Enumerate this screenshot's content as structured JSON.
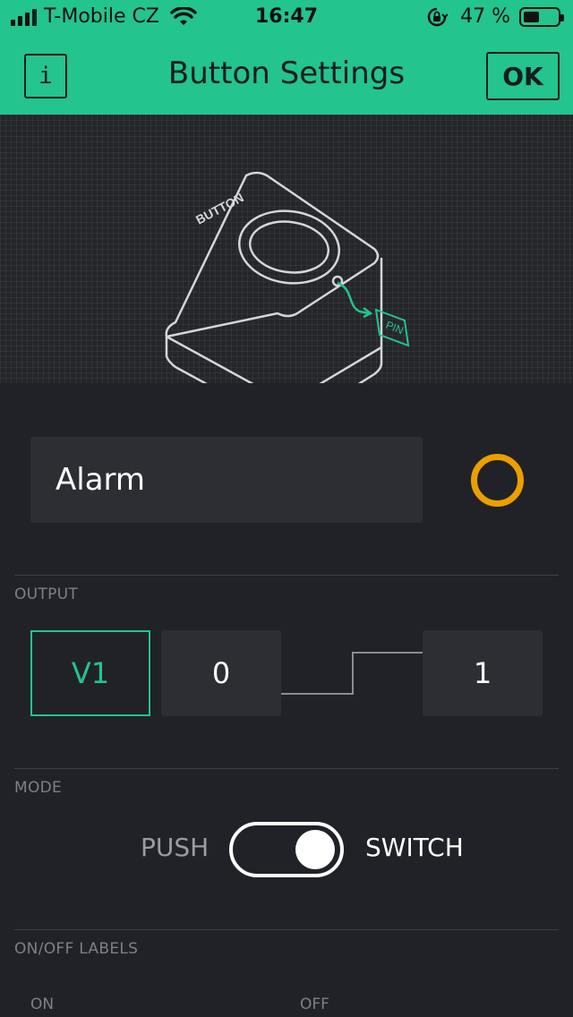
{
  "status_bar": {
    "carrier": "T-Mobile CZ",
    "time": "16:47",
    "battery_text": "47 %",
    "battery_level": 0.47
  },
  "header": {
    "info_label": "i",
    "title": "Button Settings",
    "ok_label": "OK"
  },
  "illustration": {
    "device_label": "BUTTON",
    "pin_label": "PIN"
  },
  "widget": {
    "name_value": "Alarm",
    "color": "#eb9f00"
  },
  "output": {
    "section_label": "OUTPUT",
    "pin": "V1",
    "low_value": "0",
    "high_value": "1"
  },
  "mode": {
    "section_label": "MODE",
    "left_option": "PUSH",
    "right_option": "SWITCH",
    "selected": "SWITCH"
  },
  "labels": {
    "section_label": "ON/OFF LABELS",
    "on_label": "ON",
    "off_label": "OFF"
  },
  "colors": {
    "accent": "#23c48e",
    "background": "#212227",
    "field": "#2d2e33"
  }
}
